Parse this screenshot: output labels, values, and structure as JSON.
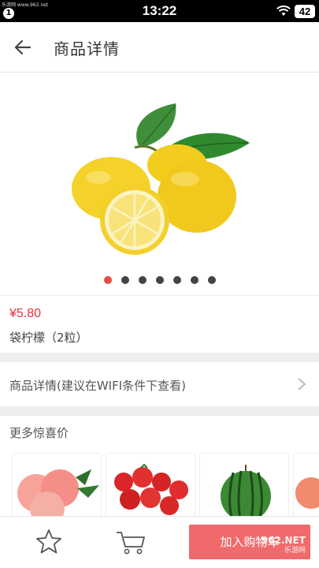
{
  "status_bar": {
    "watermark": "乐游网 www.962.net",
    "badge": "1",
    "time": "13:22",
    "battery": "42",
    "icons": [
      "wifi-icon"
    ]
  },
  "header": {
    "title": "商品详情",
    "back_icon": "arrow-left-icon"
  },
  "gallery": {
    "image": "lemon-product-image",
    "total_dots": 7,
    "active_dot": 0
  },
  "product": {
    "price": "¥5.80",
    "name": "袋柠檬（2粒）"
  },
  "detail_link": {
    "label": "商品详情(建议在WIFI条件下查看)",
    "icon": "chevron-right-icon"
  },
  "recommendations": {
    "title": "更多惊喜价",
    "items": [
      "peach-image",
      "tomato-image",
      "watermelon-image",
      "apple-image"
    ]
  },
  "bottom_bar": {
    "favorite_icon": "star-icon",
    "cart_icon": "cart-icon",
    "add_to_cart_label": "加入购物车",
    "watermark_logo": "962.NET",
    "watermark_text": "乐游网"
  },
  "colors": {
    "accent": "#e5323b",
    "button": "#f06a6c",
    "active_dot": "#e44b43",
    "separator": "#eeeeee"
  }
}
